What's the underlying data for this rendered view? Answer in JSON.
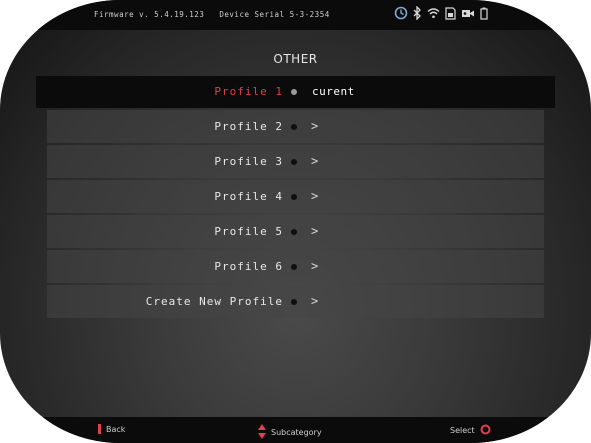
{
  "status_bar": {
    "firmware": "Firmware v. 5.4.19.123",
    "serial": "Device Serial 5-3-2354",
    "icons": [
      "timer-icon",
      "bluetooth-icon",
      "wifi-icon",
      "sd-card-icon",
      "video-camera-icon",
      "battery-icon"
    ]
  },
  "menu": {
    "title": "OTHER",
    "items": [
      {
        "label": "Profile 1",
        "value": "curent",
        "selected": true
      },
      {
        "label": "Profile 2",
        "chevron": ">"
      },
      {
        "label": "Profile 3",
        "chevron": ">"
      },
      {
        "label": "Profile 4",
        "chevron": ">"
      },
      {
        "label": "Profile 5",
        "chevron": ">"
      },
      {
        "label": "Profile 6",
        "chevron": ">"
      },
      {
        "label": "Create New Profile",
        "chevron": ">"
      }
    ]
  },
  "hints": {
    "back": "Back",
    "subcategory": "Subcategory",
    "select": "Select"
  },
  "colors": {
    "accent": "#e0404a",
    "bar_background": "#0b0b0b",
    "row_background": "#464646"
  }
}
